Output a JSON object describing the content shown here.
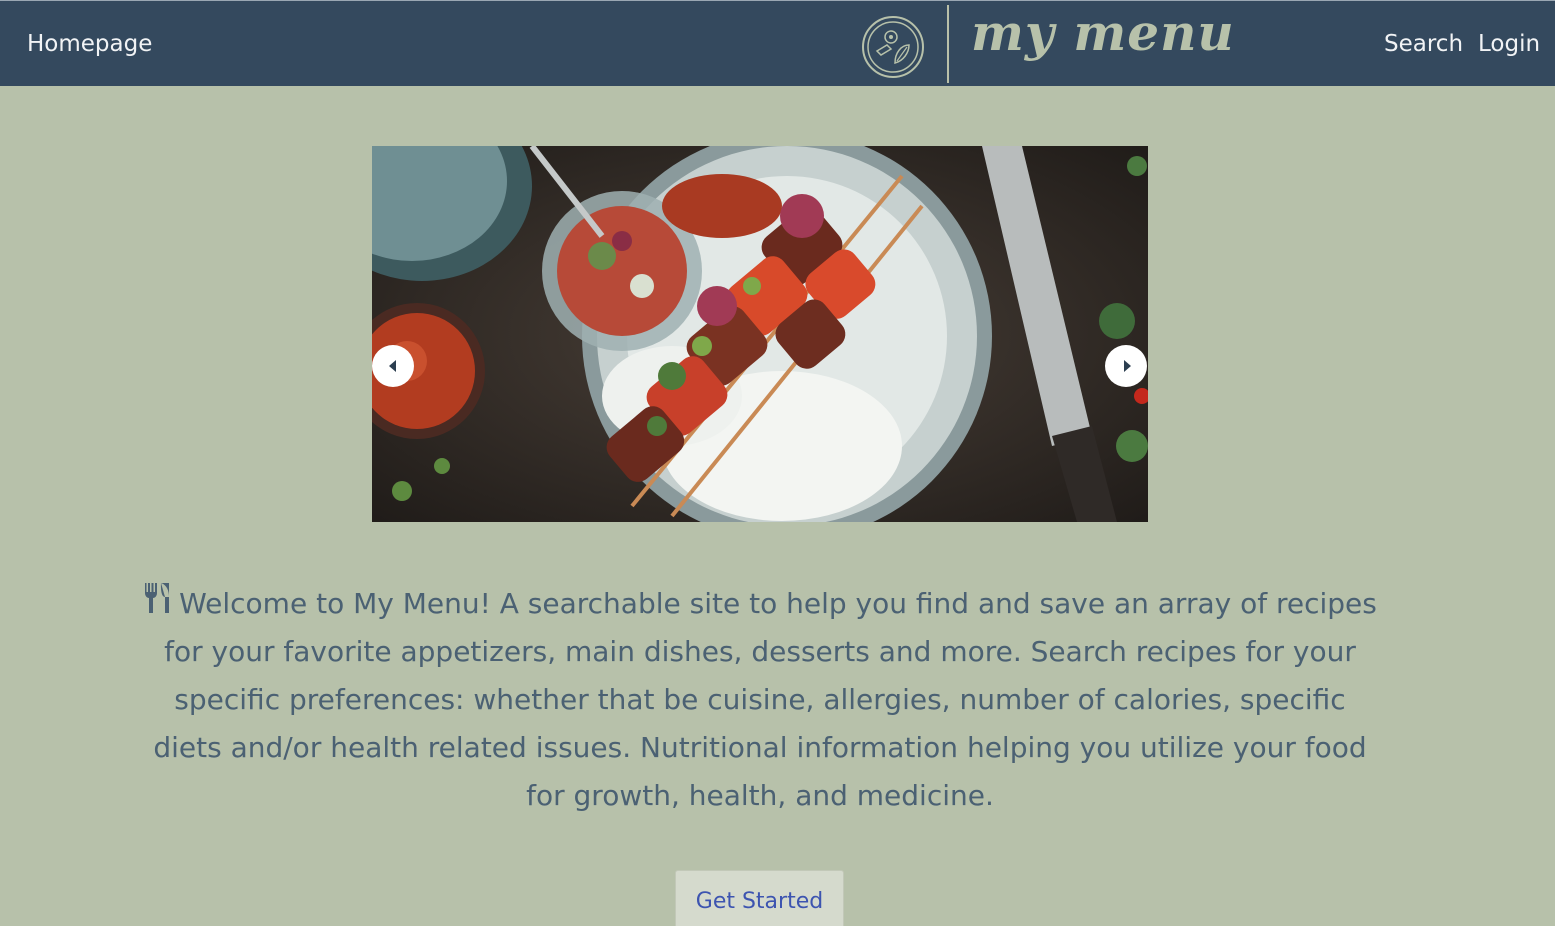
{
  "nav": {
    "home_label": "Homepage",
    "search_label": "Search",
    "login_label": "Login",
    "logo_text": "my menu",
    "logo_icon": "plate-with-leaf-emblem-icon"
  },
  "carousel": {
    "image_icon": "food-skewers-photo",
    "prev_icon": "chevron-left-icon",
    "next_icon": "chevron-right-icon"
  },
  "intro": {
    "icon": "utensils-icon",
    "text": "Welcome to My Menu! A searchable site to help you find and save an array of recipes for your favorite appetizers, main dishes, desserts and more. Search recipes for your specific preferences: whether that be cuisine, allergies, number of calories, specific diets and/or health related issues. Nutritional information helping you utilize your food for growth, health, and medicine."
  },
  "cta": {
    "label": "Get Started"
  },
  "colors": {
    "nav_bg": "#34495e",
    "page_bg": "#b7c1aa",
    "text": "#4b6173",
    "button_bg": "#d5dacd",
    "button_text": "#3d54b0"
  }
}
